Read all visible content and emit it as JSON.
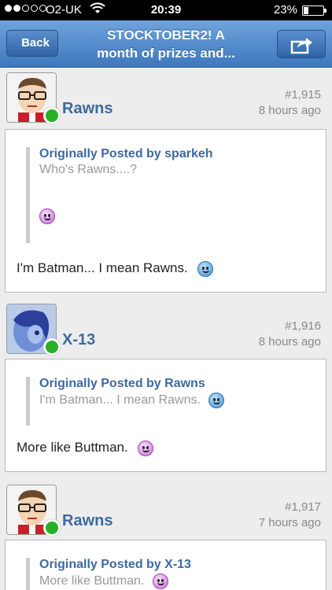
{
  "status_bar": {
    "carrier": "O2-UK",
    "time": "20:39",
    "battery": "23%",
    "battery_level": 0.23
  },
  "nav": {
    "back_label": "Back",
    "title_line1": "STOCKTOBER2! A",
    "title_line2": "month of prizes and..."
  },
  "posts": [
    {
      "username": "Rawns",
      "number": "#1,915",
      "time": "8 hours ago",
      "quote_author": "Originally Posted by sparkeh",
      "quote_text": "Who's Rawns....?",
      "text": "I'm Batman... I mean Rawns."
    },
    {
      "username": "X-13",
      "number": "#1,916",
      "time": "8 hours ago",
      "quote_author": "Originally Posted by Rawns",
      "quote_text": "I'm Batman... I mean Rawns.",
      "text": "More like Buttman."
    },
    {
      "username": "Rawns",
      "number": "#1,917",
      "time": "7 hours ago",
      "quote_author": "Originally Posted by X-13",
      "quote_text": "More like Buttman."
    }
  ],
  "colors": {
    "nav_accent": "#3e78bd",
    "username": "#3c6aa0",
    "online": "#27b026"
  }
}
